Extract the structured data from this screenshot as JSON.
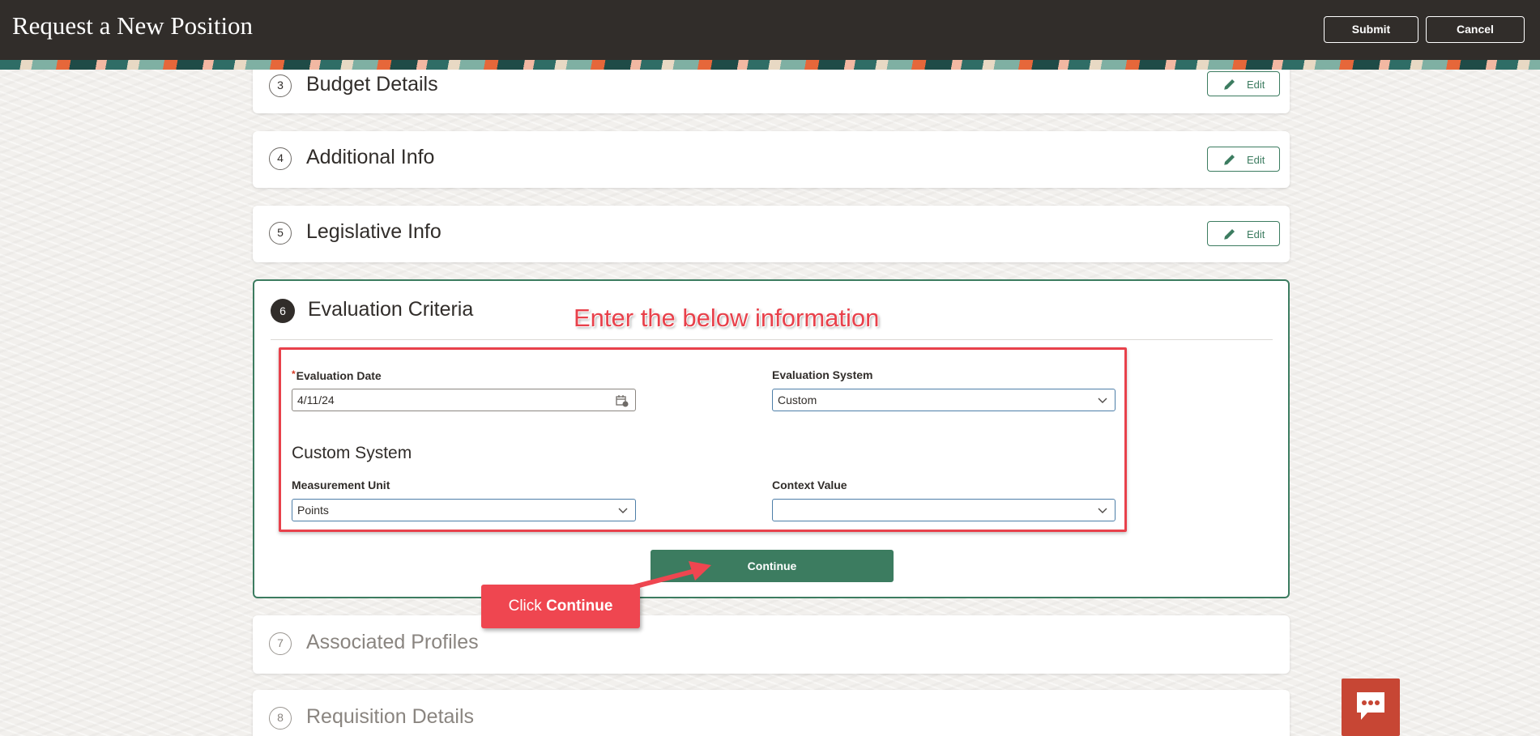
{
  "header": {
    "title": "Request a New Position",
    "submit_label": "Submit",
    "cancel_label": "Cancel"
  },
  "sections": {
    "budget": {
      "number": "3",
      "title": "Budget Details",
      "edit_label": "Edit"
    },
    "additional": {
      "number": "4",
      "title": "Additional Info",
      "edit_label": "Edit"
    },
    "legislative": {
      "number": "5",
      "title": "Legislative Info",
      "edit_label": "Edit"
    },
    "evaluation": {
      "number": "6",
      "title": "Evaluation Criteria"
    },
    "profiles": {
      "number": "7",
      "title": "Associated Profiles"
    },
    "requisition": {
      "number": "8",
      "title": "Requisition Details"
    }
  },
  "form": {
    "evaluation_date_label": "Evaluation Date",
    "evaluation_date_value": "4/11/24",
    "evaluation_system_label": "Evaluation System",
    "evaluation_system_value": "Custom",
    "custom_system_heading": "Custom System",
    "measurement_unit_label": "Measurement Unit",
    "measurement_unit_value": "Points",
    "context_value_label": "Context Value",
    "context_value_value": "",
    "continue_label": "Continue"
  },
  "annotations": {
    "instruction": "Enter the below information",
    "callout_prefix": "Click ",
    "callout_bold": "Continue"
  },
  "colors": {
    "header_bg": "#312d2a",
    "accent_green": "#3c7c60",
    "annotation_red": "#e8414b",
    "chat_bg": "#c74634"
  },
  "icons": [
    "pencil-icon",
    "calendar-icon",
    "chevron-down-icon",
    "chat-icon"
  ]
}
